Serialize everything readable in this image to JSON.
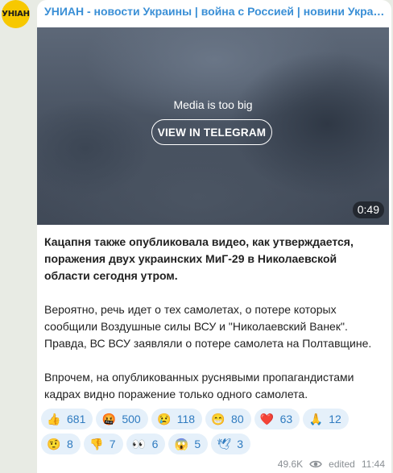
{
  "channel": {
    "title": "УНИАН - новости Украины | война с Россией | новини України...",
    "avatar_text": "УНІАН"
  },
  "media": {
    "notice": "Media is too big",
    "button_label": "VIEW IN TELEGRAM",
    "duration": "0:49"
  },
  "post": {
    "paragraphs": [
      "Кацапня также опубликовала видео, как утверждается, поражения двух украинских МиГ-29 в Николаевской области сегодня утром.",
      "Вероятно, речь идет о тех самолетах, о потере которых сообщили Воздушные силы ВСУ и \"Николаевский Ванек\". Правда, ВС ВСУ заявляли о потере самолета на Полтавщине.",
      "Впрочем, на опубликованных руснявыми пропагандистами кадрах видно поражение только одного самолета."
    ]
  },
  "reactions": {
    "row1": [
      {
        "emoji": "👍",
        "icon": "thumbs-up-icon",
        "count": "681"
      },
      {
        "emoji": "🤬",
        "icon": "angry-face-icon",
        "count": "500"
      },
      {
        "emoji": "😢",
        "icon": "crying-face-icon",
        "count": "118"
      },
      {
        "emoji": "😁",
        "icon": "grinning-face-icon",
        "count": "80"
      },
      {
        "emoji": "❤️",
        "icon": "heart-icon",
        "count": "63"
      },
      {
        "emoji": "🙏",
        "icon": "praying-hands-icon",
        "count": "12"
      }
    ],
    "row2": [
      {
        "emoji": "🤨",
        "icon": "raised-eyebrow-face-icon",
        "count": "8"
      },
      {
        "emoji": "👎",
        "icon": "thumbs-down-icon",
        "count": "7"
      },
      {
        "emoji": "👀",
        "icon": "eyes-icon",
        "count": "6"
      },
      {
        "emoji": "😱",
        "icon": "screaming-face-icon",
        "count": "5"
      },
      {
        "emoji": "🕊",
        "icon": "dove-icon",
        "count": "3"
      }
    ]
  },
  "footer": {
    "views": "49.6K",
    "edited_label": "edited",
    "time": "11:44"
  }
}
